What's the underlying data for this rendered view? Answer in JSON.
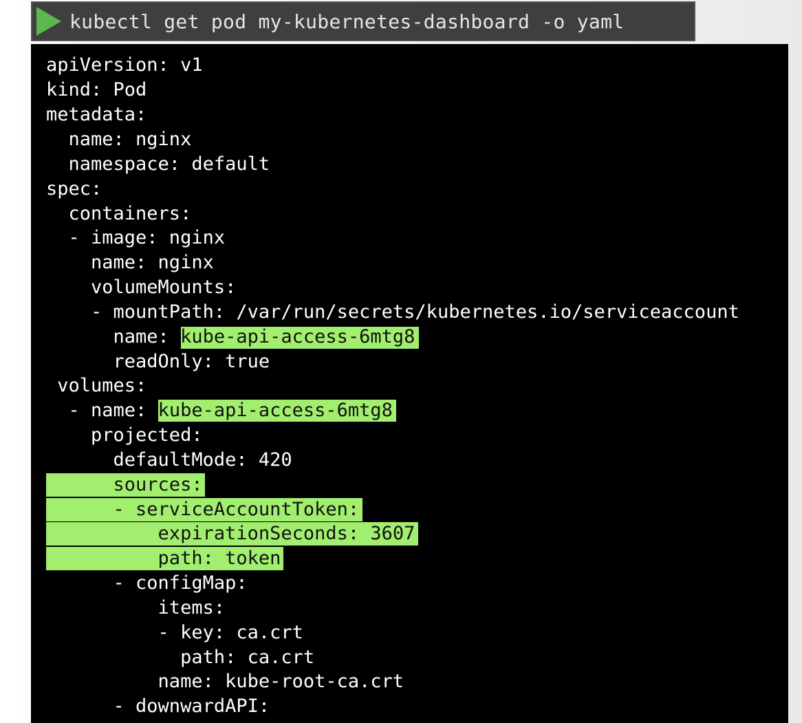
{
  "command": {
    "text": "kubectl get pod my-kubernetes-dashboard -o yaml"
  },
  "colors": {
    "highlight": "#a2ef6f",
    "terminal_bg": "#000000",
    "command_bar_bg": "#3f3f3f",
    "play_icon": "#5bb84c"
  },
  "yaml": {
    "l1": "apiVersion: v1",
    "l2": "kind: Pod",
    "l3": "metadata:",
    "l4": "  name: nginx",
    "l5": "  namespace: default",
    "l6": "spec:",
    "l7": "  containers:",
    "l8": "  - image: nginx",
    "l9": "    name: nginx",
    "l10": "    volumeMounts:",
    "l11": "    - mountPath: /var/run/secrets/kubernetes.io/serviceaccount",
    "l12_key": "      name: ",
    "l12_val": "kube-api-access-6mtg8",
    "l13": "      readOnly: true",
    "l14": " volumes:",
    "l15_key": "  - name: ",
    "l15_val": "kube-api-access-6mtg8",
    "l16": "    projected:",
    "l17": "      defaultMode: 420",
    "l18": "      sources:",
    "l19": "      - serviceAccountToken:",
    "l20": "          expirationSeconds: 3607",
    "l21": "          path: token",
    "l22": "      - configMap:",
    "l23": "          items:",
    "l24": "          - key: ca.crt",
    "l25": "            path: ca.crt",
    "l26": "          name: kube-root-ca.crt",
    "l27": "      - downwardAPI:"
  }
}
